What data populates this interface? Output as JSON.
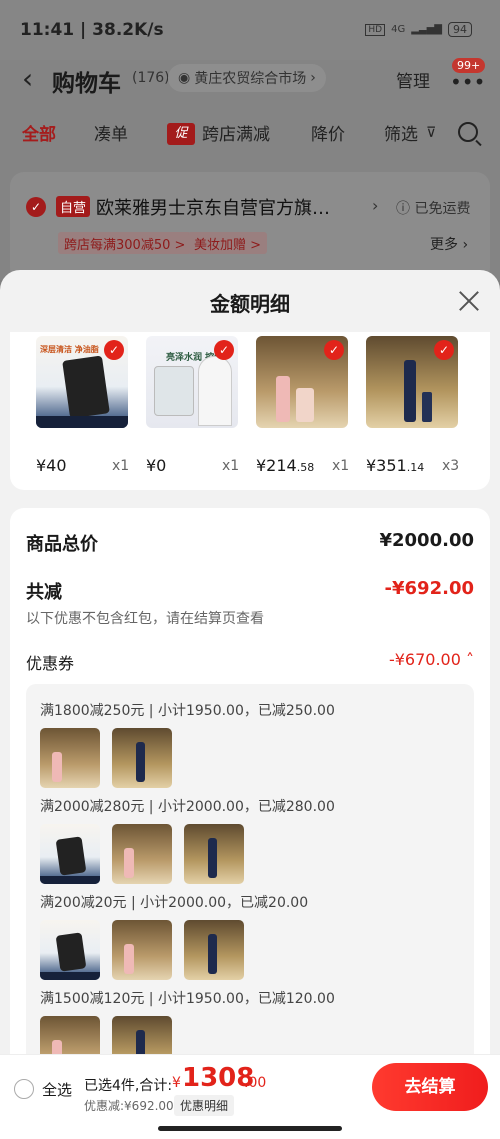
{
  "status_bar": {
    "time": "11:41 | 38.2K/s",
    "hd": "HD",
    "signal": "4G",
    "battery": "94"
  },
  "header": {
    "title": "购物车",
    "count": "(176)",
    "location": "黄庄农贸综合市场",
    "manage": "管理",
    "badge": "99+"
  },
  "tabs": [
    "全部",
    "凑单",
    "跨店满减",
    "降价",
    "筛选"
  ],
  "tab_promo_tag": "促",
  "store": {
    "tag": "自营",
    "name": "欧莱雅男士京东自营官方旗…",
    "shipping": "已免运费",
    "promo1": "跨店每满300减50 >",
    "promo2": "美妆加赠 >",
    "more": "更多"
  },
  "sheet": {
    "title": "金额明细",
    "products": [
      {
        "price": "¥40",
        "price_dec": "",
        "qty": "x1",
        "img_text": "深层清洁 净油脂"
      },
      {
        "price": "¥0",
        "price_dec": "",
        "qty": "x1",
        "img_text": "亮泽水润 控油"
      },
      {
        "price": "¥214",
        "price_dec": ".58",
        "qty": "x1",
        "img_text": ""
      },
      {
        "price": "¥351",
        "price_dec": ".14",
        "qty": "x3",
        "img_text": ""
      }
    ],
    "total_label": "商品总价",
    "total_value": "¥2000.00",
    "reduce_label": "共减",
    "reduce_value": "-¥692.00",
    "note": "以下优惠不包含红包，请在结算页查看",
    "coupon_label": "优惠券",
    "coupon_value": "-¥670.00",
    "coupon_rules": [
      "满1800减250元 | 小计1950.00，已减250.00",
      "满2000减280元 | 小计2000.00，已减280.00",
      "满200减20元 | 小计2000.00，已减20.00",
      "满1500减120元 | 小计1950.00，已减120.00"
    ]
  },
  "bottom": {
    "select_all": "全选",
    "summary_label": "已选4件,合计:",
    "currency": "¥",
    "amount": "1308",
    "amount_dec": ".00",
    "discount": "优惠减:¥692.00",
    "detail_button": "优惠明细",
    "checkout_button": "去结算"
  }
}
